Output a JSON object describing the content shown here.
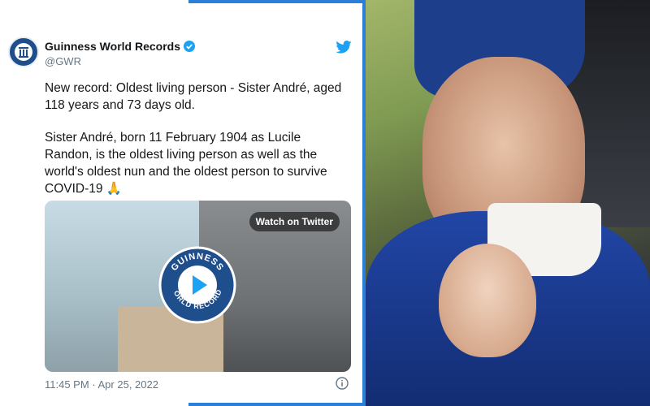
{
  "tweet": {
    "display_name": "Guinness World Records",
    "handle": "@GWR",
    "paragraph1": "New record: Oldest living person - Sister André, aged 118 years and 73 days old.",
    "paragraph2": "Sister André, born 11 February 1904 as Lucile Randon, is the oldest living person as well as the world's oldest nun and the oldest person to survive COVID-19",
    "emoji": "🙏",
    "media": {
      "watch_label": "Watch on Twitter",
      "badge_text": "GUINNESS WORLD RECORDS"
    },
    "timestamp": "11:45 PM · Apr 25, 2022"
  },
  "icons": {
    "avatar": "gwr-logo-icon",
    "verified": "verified-badge-icon",
    "brand": "twitter-bird-icon",
    "play": "play-icon",
    "info": "info-icon"
  },
  "colors": {
    "accent": "#2b7fd8",
    "twitter_blue": "#1da1f2",
    "gwr_blue": "#1f4e8c"
  }
}
